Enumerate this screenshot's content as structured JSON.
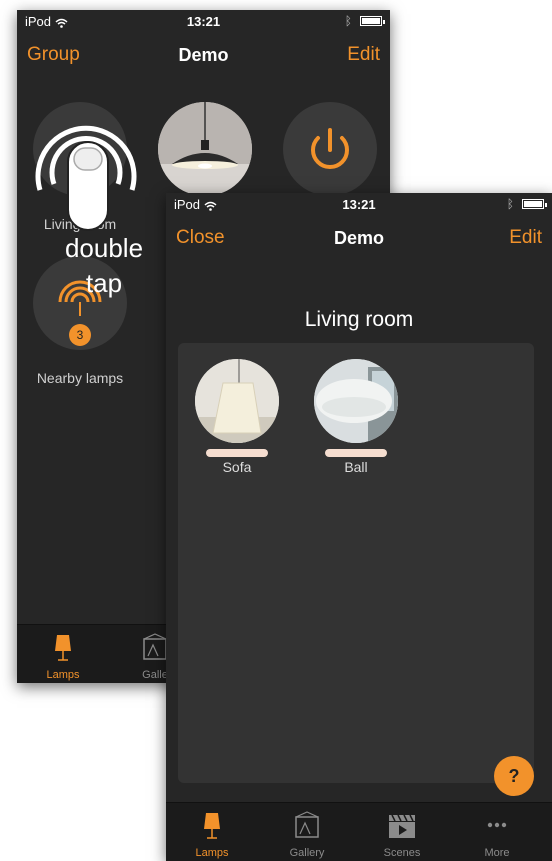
{
  "back_screen": {
    "status": {
      "carrier": "iPod",
      "time": "13:21"
    },
    "nav": {
      "left": "Group",
      "title": "Demo",
      "right": "Edit"
    },
    "items": [
      {
        "label": "Living room"
      },
      {
        "label": ""
      },
      {
        "label": ""
      },
      {
        "label": "Nearby lamps",
        "badge": "3"
      }
    ],
    "tabs": [
      {
        "label": "Lamps",
        "icon": "lamp-icon",
        "active": true
      },
      {
        "label": "Galle",
        "icon": "gallery-icon",
        "active": false
      }
    ]
  },
  "gesture": {
    "line1": "double",
    "line2": "tap"
  },
  "front_screen": {
    "status": {
      "carrier": "iPod",
      "time": "13:21"
    },
    "nav": {
      "left": "Close",
      "title": "Demo",
      "right": "Edit"
    },
    "room_title": "Living room",
    "lamps": [
      {
        "name": "Sofa"
      },
      {
        "name": "Ball"
      }
    ],
    "help": "?",
    "tabs": [
      {
        "label": "Lamps",
        "icon": "lamp-icon",
        "active": true
      },
      {
        "label": "Gallery",
        "icon": "gallery-icon",
        "active": false
      },
      {
        "label": "Scenes",
        "icon": "scenes-icon",
        "active": false
      },
      {
        "label": "More",
        "icon": "more-icon",
        "active": false
      }
    ]
  },
  "colors": {
    "accent": "#f2922b",
    "background": "#262626",
    "panel": "#333333"
  }
}
